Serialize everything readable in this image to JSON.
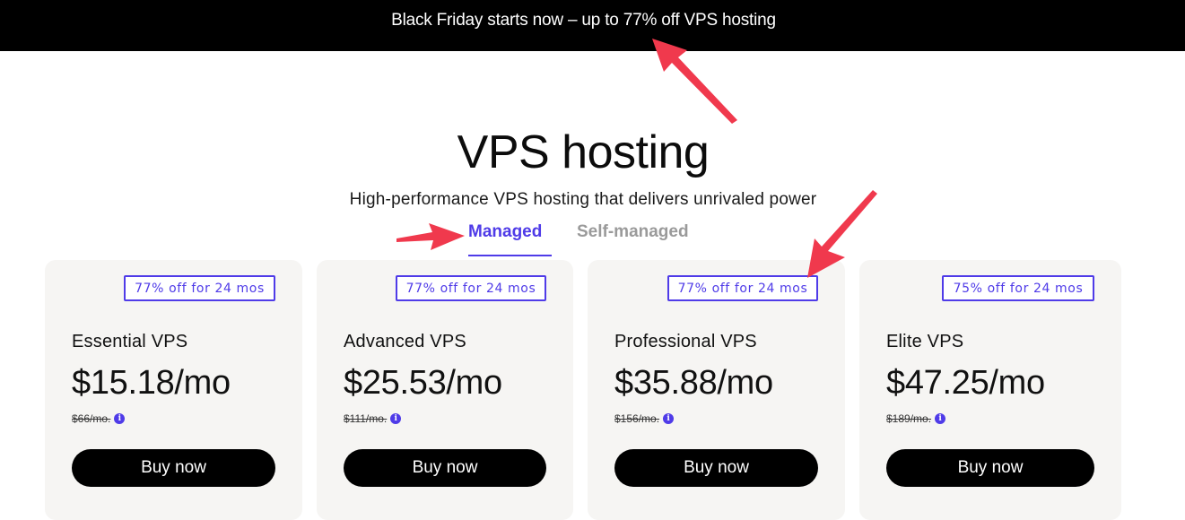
{
  "promo": {
    "text": "Black Friday starts now – up to 77% off VPS hosting"
  },
  "header": {
    "title": "VPS hosting",
    "subtitle": "High-performance VPS hosting that delivers unrivaled power"
  },
  "tabs": [
    {
      "label": "Managed",
      "active": true
    },
    {
      "label": "Self-managed",
      "active": false
    }
  ],
  "plans": [
    {
      "badge": "77% off for 24 mos",
      "name": "Essential VPS",
      "price": "$15.18/mo",
      "old_price": "$66/mo.",
      "button": "Buy now"
    },
    {
      "badge": "77% off for 24 mos",
      "name": "Advanced VPS",
      "price": "$25.53/mo",
      "old_price": "$111/mo.",
      "button": "Buy now"
    },
    {
      "badge": "77% off for 24 mos",
      "name": "Professional VPS",
      "price": "$35.88/mo",
      "old_price": "$156/mo.",
      "button": "Buy now"
    },
    {
      "badge": "75% off for 24 mos",
      "name": "Elite VPS",
      "price": "$47.25/mo",
      "old_price": "$189/mo.",
      "button": "Buy now"
    }
  ],
  "icons": {
    "info": "info-icon",
    "annotation": "red-arrow"
  },
  "colors": {
    "accent": "#4f3be8",
    "annotation": "#f0394d",
    "promo_bg": "#000000",
    "card_bg": "#f6f5f3"
  }
}
